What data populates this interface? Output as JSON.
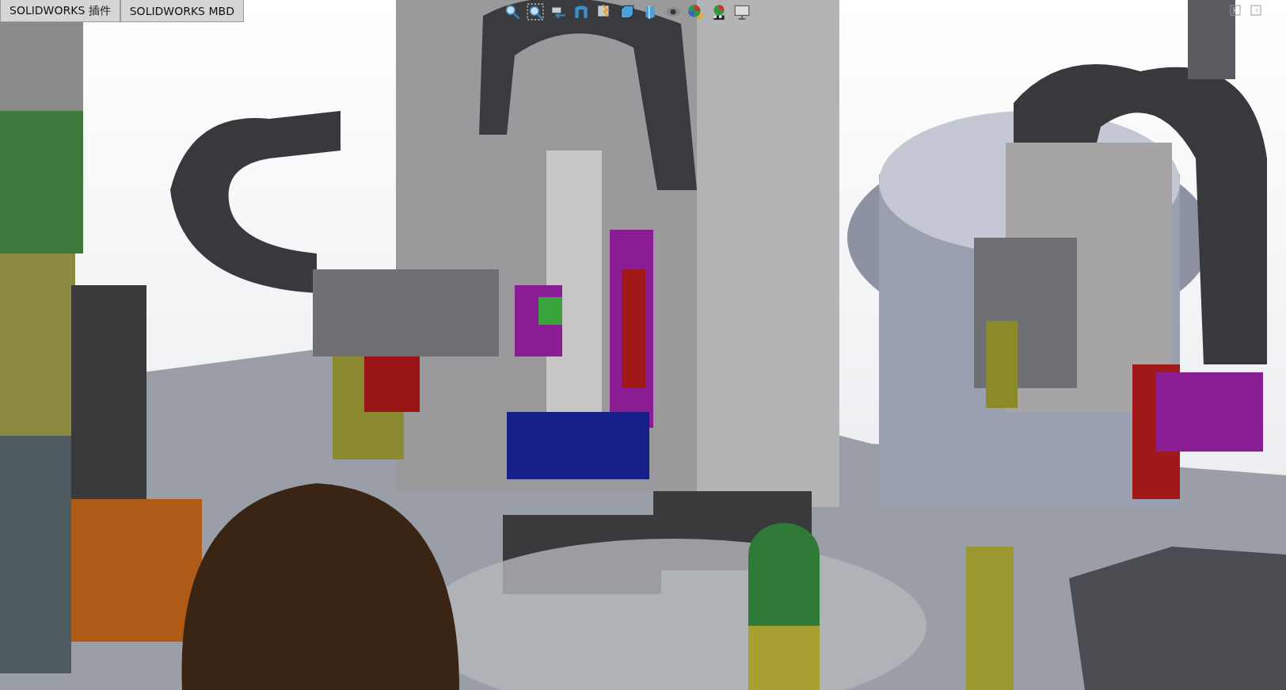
{
  "tabs": [
    {
      "label": "SOLIDWORKS 插件"
    },
    {
      "label": "SOLIDWORKS MBD"
    }
  ]
}
